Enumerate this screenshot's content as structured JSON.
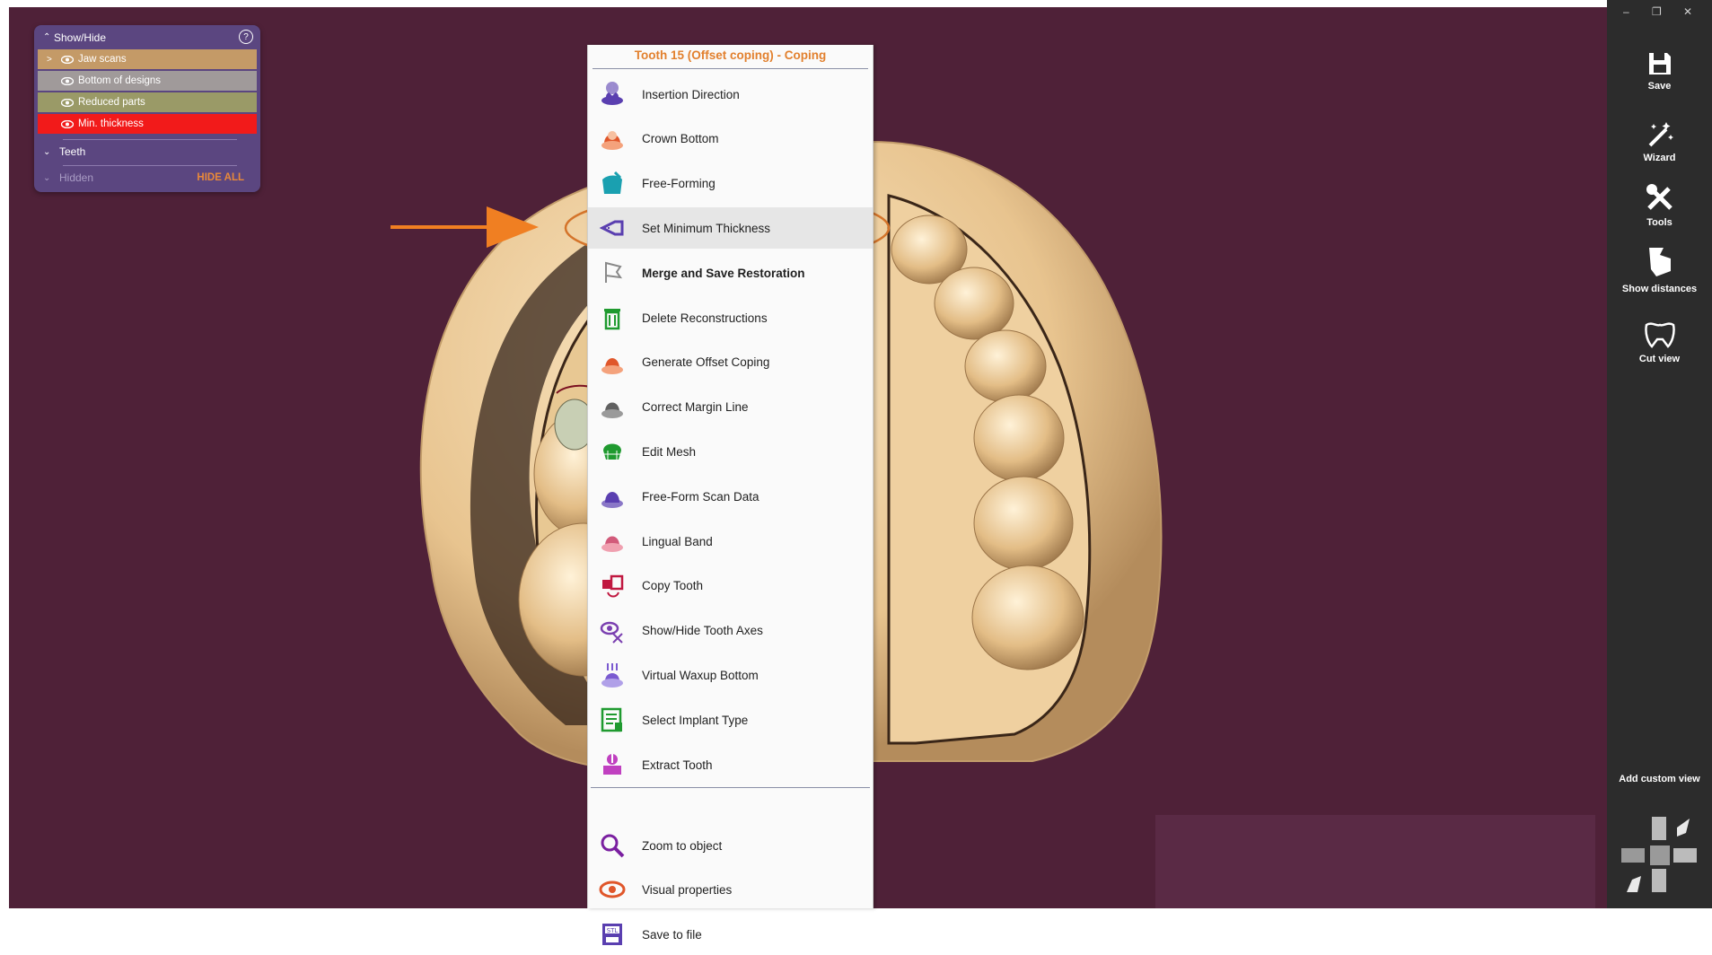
{
  "show_hide": {
    "title": "Show/Hide",
    "help_icon": "?",
    "items": [
      {
        "label": "Jaw scans",
        "color": "#c49a67",
        "expand": ">"
      },
      {
        "label": "Bottom of designs",
        "color": "#a09a9a",
        "expand": ""
      },
      {
        "label": "Reduced parts",
        "color": "#9a9a67",
        "expand": ""
      },
      {
        "label": "Min. thickness",
        "color": "#f21a1a",
        "expand": ""
      }
    ],
    "teeth_label": "Teeth",
    "hidden_label": "Hidden",
    "hide_all_label": "HIDE ALL"
  },
  "menu": {
    "title": "Tooth 15 (Offset coping) - Coping",
    "items": [
      {
        "label": "Insertion Direction",
        "icon": "insertion-direction-icon",
        "color": "#5a3fb0"
      },
      {
        "label": "Crown Bottom",
        "icon": "crown-bottom-icon",
        "color": "#e0562a"
      },
      {
        "label": "Free-Forming",
        "icon": "free-forming-icon",
        "color": "#1aa0b0"
      },
      {
        "label": "Set Minimum Thickness",
        "icon": "set-minimum-thickness-icon",
        "color": "#5a3fb0"
      },
      {
        "label": "Merge and Save Restoration",
        "icon": "merge-save-icon",
        "color": "#888888"
      },
      {
        "label": "Delete Reconstructions",
        "icon": "trash-icon",
        "color": "#1f9a2f"
      },
      {
        "label": "Generate Offset Coping",
        "icon": "generate-offset-coping-icon",
        "color": "#e0562a"
      },
      {
        "label": "Correct Margin Line",
        "icon": "correct-margin-line-icon",
        "color": "#606060"
      },
      {
        "label": "Edit Mesh",
        "icon": "edit-mesh-icon",
        "color": "#1f9a2f"
      },
      {
        "label": "Free-Form Scan Data",
        "icon": "free-form-scan-data-icon",
        "color": "#5a3fb0"
      },
      {
        "label": "Lingual Band",
        "icon": "lingual-band-icon",
        "color": "#d25a7a"
      },
      {
        "label": "Copy Tooth",
        "icon": "copy-tooth-icon",
        "color": "#c01840"
      },
      {
        "label": "Show/Hide Tooth Axes",
        "icon": "tooth-axes-icon",
        "color": "#7a3fb0"
      },
      {
        "label": "Virtual Waxup Bottom",
        "icon": "virtual-waxup-icon",
        "color": "#7a5ad0"
      },
      {
        "label": "Select Implant Type",
        "icon": "implant-type-icon",
        "color": "#1f9a2f"
      },
      {
        "label": "Extract Tooth",
        "icon": "extract-tooth-icon",
        "color": "#c040c0"
      },
      {
        "label": "Zoom to object",
        "icon": "zoom-icon",
        "color": "#7a1fa0"
      },
      {
        "label": "Visual properties",
        "icon": "eye-icon",
        "color": "#e0562a"
      },
      {
        "label": "Save to file",
        "icon": "stl-file-icon",
        "color": "#5a3fb0"
      }
    ]
  },
  "toolbar": {
    "save_label": "Save",
    "wizard_label": "Wizard",
    "tools_label": "Tools",
    "show_distances_label": "Show distances",
    "cut_view_label": "Cut view",
    "add_custom_view_label": "Add custom view"
  },
  "colors": {
    "viewport_bg": "#4f2138",
    "model": "#f7dba9",
    "menu_title": "#e2802e",
    "arrow": "#f07f22",
    "toolbar_bg": "#2c2c2c"
  }
}
